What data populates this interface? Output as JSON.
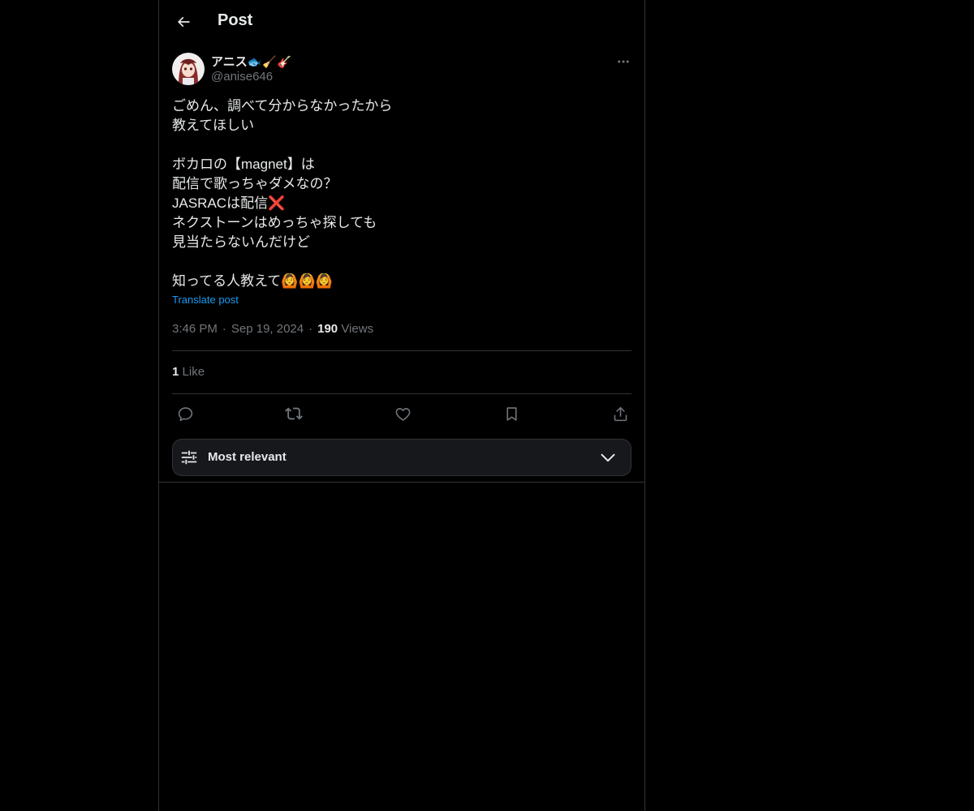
{
  "header": {
    "title": "Post"
  },
  "author": {
    "name": "アニス",
    "name_emoji": "🐟🧹🎸",
    "handle": "@anise646"
  },
  "post": {
    "lines": [
      "ごめん、調べて分からなかったから",
      "教えてほしい",
      "",
      "ボカロの【magnet】は",
      "配信で歌っちゃダメなの？",
      "JASRACは配信❌",
      "ネクストーンはめっちゃ探しても",
      "見当たらないんだけど",
      "",
      "知ってる人教えて🙆🙆🙆"
    ],
    "translate_label": "Translate post",
    "time": "3:46 PM",
    "date": "Sep 19, 2024",
    "views_count": "190",
    "views_label": "Views"
  },
  "engagement": {
    "likes_count": "1",
    "likes_label": "Like"
  },
  "sort": {
    "label": "Most relevant"
  },
  "icons": {
    "back": "arrow-left-icon",
    "more": "more-horizontal-icon",
    "reply": "reply-icon",
    "repost": "repost-icon",
    "like": "heart-icon",
    "bookmark": "bookmark-icon",
    "share": "share-icon",
    "sort": "sliders-icon",
    "chevron": "chevron-down-icon"
  },
  "colors": {
    "background": "#000000",
    "text": "#e7e9ea",
    "secondary": "#71767b",
    "accent": "#1d9bf0",
    "border": "#2f3336"
  }
}
